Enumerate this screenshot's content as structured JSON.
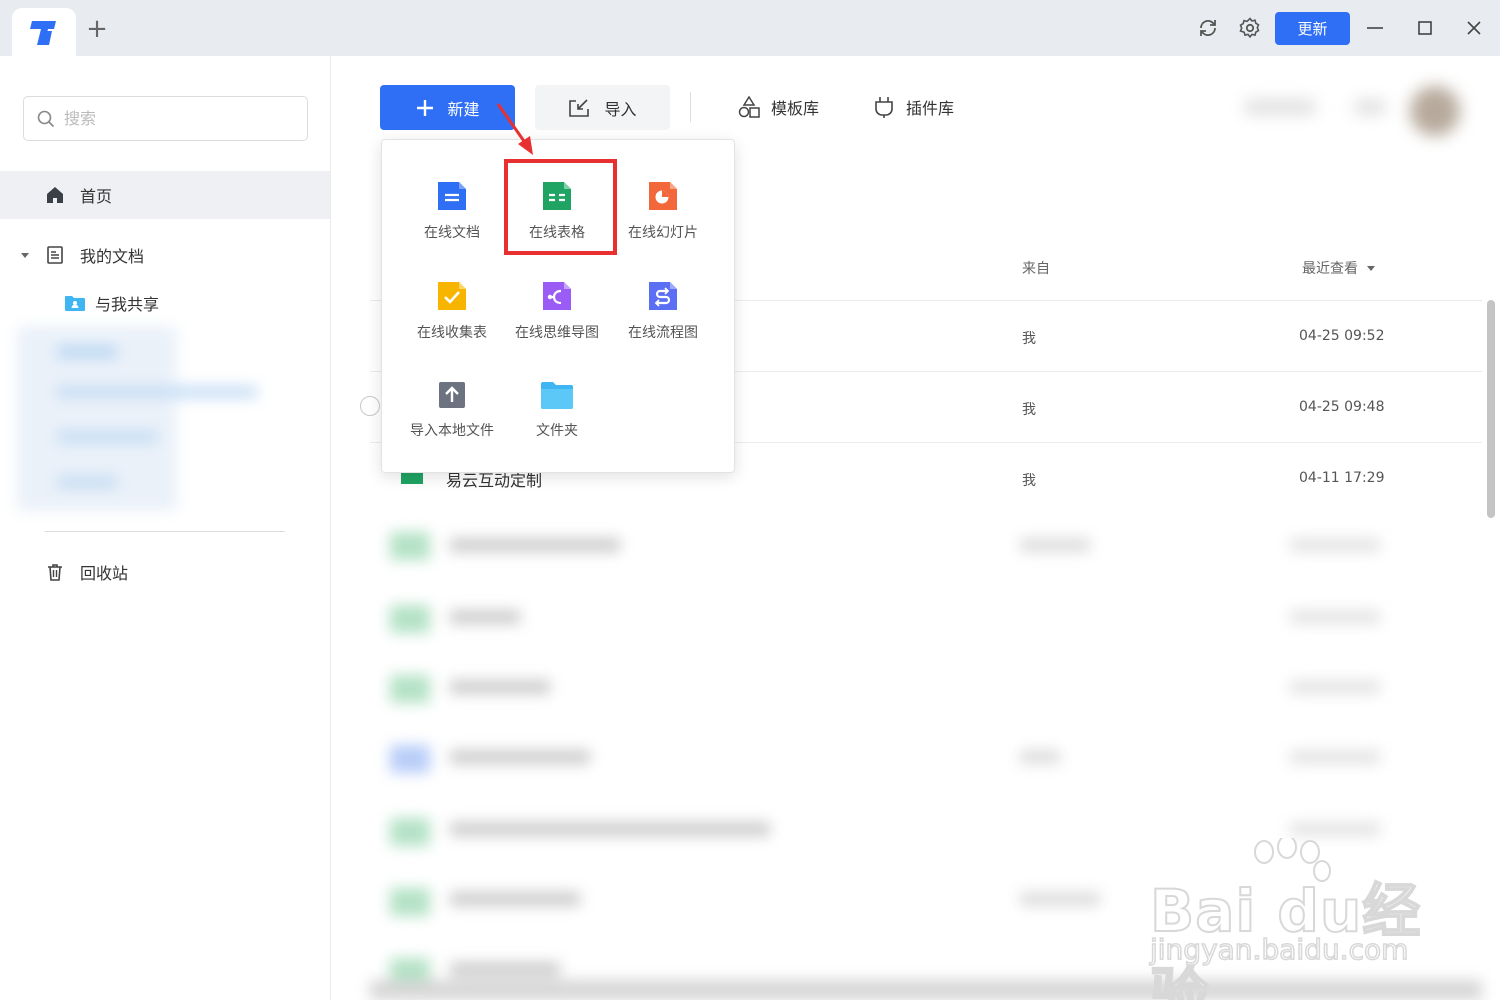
{
  "titlebar": {
    "update_label": "更新",
    "icons": [
      "app-logo-icon",
      "add-tab-icon",
      "sync-icon",
      "settings-icon",
      "minimize-icon",
      "maximize-icon",
      "close-icon"
    ]
  },
  "sidebar": {
    "search_placeholder": "搜索",
    "home_label": "首页",
    "my_docs_label": "我的文档",
    "shared_label": "与我共享",
    "trash_label": "回收站"
  },
  "toolbar": {
    "new_label": "新建",
    "import_label": "导入",
    "templates_label": "模板库",
    "plugins_label": "插件库"
  },
  "list": {
    "col_from": "来自",
    "col_recent": "最近查看",
    "rows": [
      {
        "name": "",
        "from": "我",
        "time": "04-25 09:52"
      },
      {
        "name": "",
        "from": "我",
        "time": "04-25 09:48"
      },
      {
        "name": "易云互动定制",
        "from": "我",
        "time": "04-11 17:29"
      }
    ]
  },
  "dropdown": {
    "items": [
      {
        "label": "在线文档",
        "icon": "doc-icon"
      },
      {
        "label": "在线表格",
        "icon": "sheet-icon"
      },
      {
        "label": "在线幻灯片",
        "icon": "slides-icon"
      },
      {
        "label": "在线收集表",
        "icon": "form-icon"
      },
      {
        "label": "在线思维导图",
        "icon": "mindmap-icon"
      },
      {
        "label": "在线流程图",
        "icon": "flowchart-icon"
      },
      {
        "label": "导入本地文件",
        "icon": "upload-icon"
      },
      {
        "label": "文件夹",
        "icon": "folder-icon"
      }
    ]
  },
  "watermark": {
    "brand": "Bai du经验",
    "url": "jingyan.baidu.com"
  },
  "colors": {
    "accent": "#2f6ff5",
    "highlight": "#e83030",
    "sheet_green": "#1fa463",
    "doc_blue": "#2f6ff5",
    "slides_orange": "#f2683a",
    "form_yellow": "#f7b500",
    "mindmap_purple": "#9b5cf5",
    "flow_indigo": "#5b6ff5",
    "folder_cyan": "#3fb6f2"
  }
}
